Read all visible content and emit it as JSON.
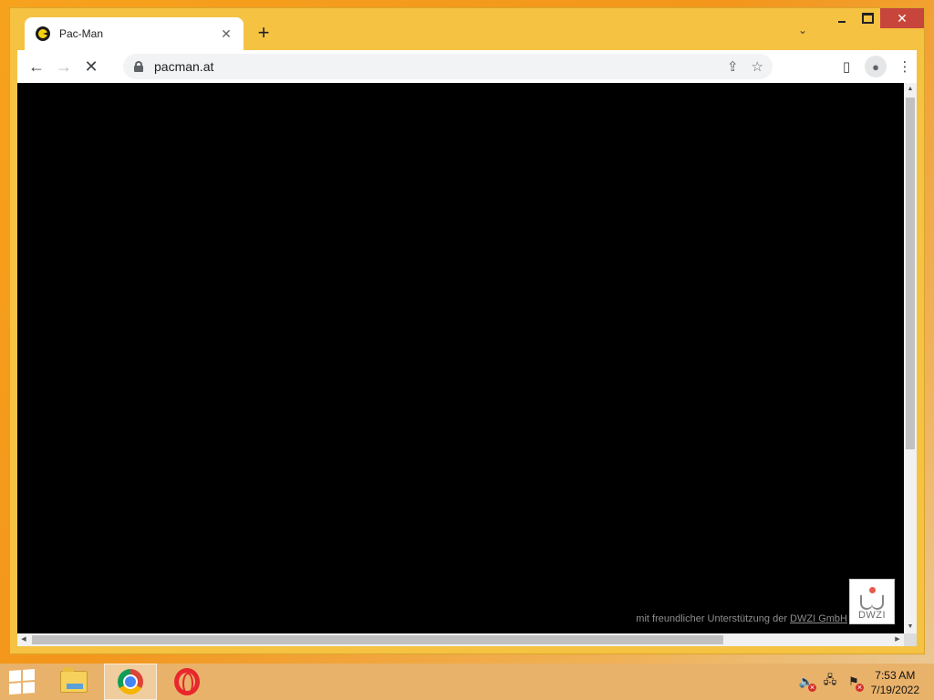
{
  "browser": {
    "tab": {
      "title": "Pac-Man",
      "favicon": "pacman-icon"
    },
    "new_tab_label": "+",
    "tab_search_icon": "chevron-down-icon",
    "window_controls": {
      "minimize": "minimize-icon",
      "maximize": "maximize-icon",
      "close": "✕"
    },
    "toolbar": {
      "back": "←",
      "forward": "→",
      "reload_stop": "✕",
      "url": "pacman.at",
      "share_icon": "share-icon",
      "bookmark_icon": "☆",
      "side_panel_icon": "side-panel-icon",
      "profile_icon": "person-icon",
      "menu_icon": "⋮"
    }
  },
  "page": {
    "background": "#000000",
    "credit_prefix": "mit freundlicher Unterstützung der ",
    "credit_link": "DWZI GmbH",
    "logo_text": "DWZI"
  },
  "scrollbars": {
    "up": "▲",
    "down": "▼",
    "left": "◀",
    "right": "▶"
  },
  "taskbar": {
    "apps": [
      {
        "name": "File Explorer",
        "icon": "folder-icon"
      },
      {
        "name": "Google Chrome",
        "icon": "chrome-icon",
        "active": true
      },
      {
        "name": "Opera",
        "icon": "opera-icon"
      }
    ],
    "tray": {
      "volume": "🔈",
      "network": "🖧",
      "flag": "⚑",
      "alert": "x"
    },
    "clock": {
      "time": "7:53 AM",
      "date": "7/19/2022"
    }
  },
  "colors": {
    "title_bar": "#f5c242",
    "close_button": "#c7453a",
    "desktop": "#f7a21c"
  }
}
